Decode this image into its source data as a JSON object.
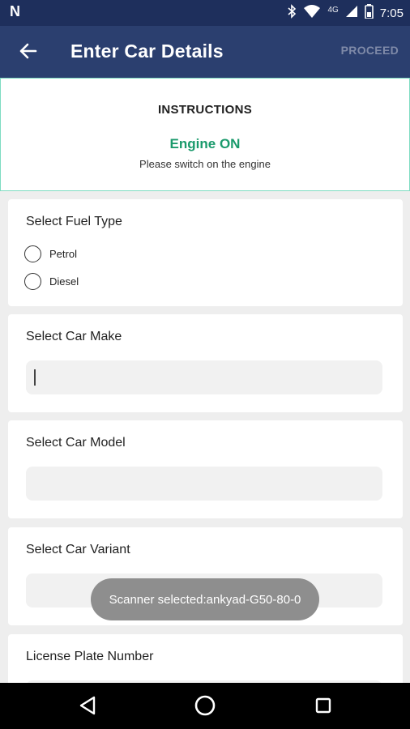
{
  "status_bar": {
    "network": "4G",
    "time": "7:05",
    "icons": [
      "notification-n-icon",
      "bluetooth-icon",
      "wifi-icon",
      "signal-icon",
      "battery-icon"
    ]
  },
  "app_bar": {
    "title": "Enter Car Details",
    "proceed_label": "PROCEED"
  },
  "instructions": {
    "heading": "INSTRUCTIONS",
    "status": "Engine ON",
    "description": "Please switch on the engine"
  },
  "fuel_type": {
    "label": "Select Fuel Type",
    "options": [
      "Petrol",
      "Diesel"
    ]
  },
  "car_make": {
    "label": "Select Car Make",
    "value": ""
  },
  "car_model": {
    "label": "Select Car Model",
    "value": ""
  },
  "car_variant": {
    "label": "Select Car Variant",
    "value": ""
  },
  "license_plate": {
    "label": "License Plate Number",
    "value": ""
  },
  "toast": {
    "text": "Scanner selected:ankyad-G50-80-0"
  },
  "colors": {
    "app_bar": "#2b3f6f",
    "status_bar": "#1e2f5c",
    "accent_green": "#1a9a6c",
    "instructions_border": "#7edcc2"
  }
}
